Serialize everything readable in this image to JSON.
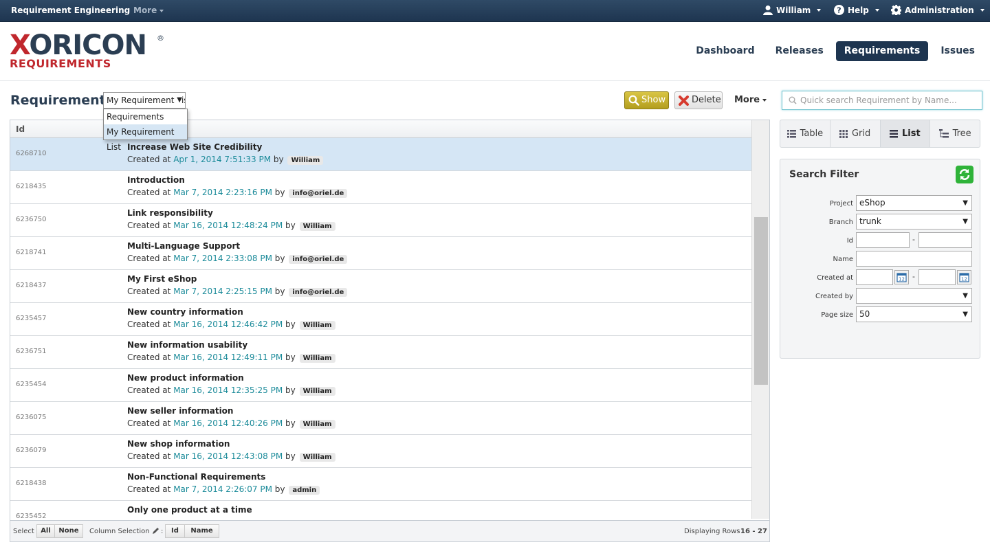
{
  "topbar": {
    "app_title": "Requirement Engineering",
    "more_label": "More",
    "user_label": "William",
    "help_label": "Help",
    "admin_label": "Administration"
  },
  "header": {
    "logo_word_first": "X",
    "logo_word_rest": "ORICON",
    "logo_registered": "®",
    "logo_subtitle": "REQUIREMENTS",
    "nav": [
      {
        "label": "Dashboard",
        "active": false
      },
      {
        "label": "Releases",
        "active": false
      },
      {
        "label": "Requirements",
        "active": true
      },
      {
        "label": "Issues",
        "active": false
      }
    ]
  },
  "toolbar": {
    "page_title": "Requirements",
    "list_select_value": "My Requirement List",
    "list_options": [
      "Requirements",
      "My Requirement List"
    ],
    "show_label": "Show",
    "delete_label": "Delete",
    "more_label": "More"
  },
  "grid": {
    "id_header": "Id",
    "created_prefix": "Created at",
    "by_label": "by",
    "rows": [
      {
        "id": "6268710",
        "name": "Increase Web Site Credibility",
        "created": "Apr 1, 2014 7:51:33 PM",
        "user": "William",
        "selected": true
      },
      {
        "id": "6218435",
        "name": "Introduction",
        "created": "Mar 7, 2014 2:23:16 PM",
        "user": "info@oriel.de"
      },
      {
        "id": "6236750",
        "name": "Link responsibility",
        "created": "Mar 16, 2014 12:48:24 PM",
        "user": "William"
      },
      {
        "id": "6218741",
        "name": "Multi-Language Support",
        "created": "Mar 7, 2014 2:33:08 PM",
        "user": "info@oriel.de"
      },
      {
        "id": "6218437",
        "name": "My First eShop",
        "created": "Mar 7, 2014 2:25:15 PM",
        "user": "info@oriel.de"
      },
      {
        "id": "6235457",
        "name": "New country information",
        "created": "Mar 16, 2014 12:46:42 PM",
        "user": "William"
      },
      {
        "id": "6236751",
        "name": "New information usability",
        "created": "Mar 16, 2014 12:49:11 PM",
        "user": "William"
      },
      {
        "id": "6235454",
        "name": "New product information",
        "created": "Mar 16, 2014 12:35:25 PM",
        "user": "William"
      },
      {
        "id": "6236075",
        "name": "New seller information",
        "created": "Mar 16, 2014 12:40:26 PM",
        "user": "William"
      },
      {
        "id": "6236079",
        "name": "New shop information",
        "created": "Mar 16, 2014 12:43:08 PM",
        "user": "William"
      },
      {
        "id": "6218438",
        "name": "Non-Functional Requirements",
        "created": "Mar 7, 2014 2:26:07 PM",
        "user": "admin"
      },
      {
        "id": "6235452",
        "name": "Only one product at a time",
        "created": "",
        "user": ""
      }
    ],
    "footer": {
      "select_label": "Select",
      "all_label": "All",
      "none_label": "None",
      "column_selection_label": "Column Selection",
      "col_id_label": "Id",
      "col_name_label": "Name",
      "displaying_label": "Displaying Rows",
      "displaying_range": "16 - 27"
    }
  },
  "sidebar": {
    "search_placeholder": "Quick search Requirement by Name...",
    "views": [
      {
        "label": "Table",
        "icon": "table-icon",
        "active": false
      },
      {
        "label": "Grid",
        "icon": "grid-icon",
        "active": false
      },
      {
        "label": "List",
        "icon": "list-icon",
        "active": true
      },
      {
        "label": "Tree",
        "icon": "tree-icon",
        "active": false
      }
    ],
    "filter": {
      "title": "Search Filter",
      "project_label": "Project",
      "project_value": "eShop",
      "branch_label": "Branch",
      "branch_value": "trunk",
      "id_label": "Id",
      "name_label": "Name",
      "created_at_label": "Created at",
      "created_by_label": "Created by",
      "created_by_value": "",
      "page_size_label": "Page size",
      "page_size_value": "50",
      "range_dash": "-"
    }
  },
  "colors": {
    "topbar": "#1e3550",
    "accent_teal": "#1a8a99",
    "logo_red": "#c0272d",
    "show_button": "#c4b02a",
    "refresh_green": "#2fb339",
    "selected_row": "#d5e6f5"
  }
}
